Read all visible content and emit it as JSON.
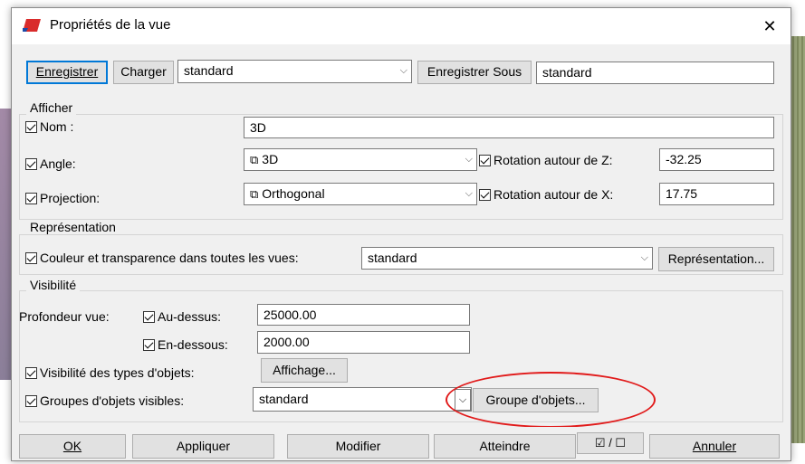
{
  "window": {
    "title": "Propriétés de la vue",
    "close_glyph": "✕"
  },
  "toolbar": {
    "save_label": "Enregistrer",
    "load_label": "Charger",
    "preset_value": "standard",
    "save_as_label": "Enregistrer Sous",
    "save_as_value": "standard"
  },
  "afficher": {
    "legend": "Afficher",
    "nom_label": "Nom :",
    "nom_value": "3D",
    "angle_label": "Angle:",
    "angle_value": "3D",
    "projection_label": "Projection:",
    "projection_value": "Orthogonal",
    "rot_z_label": "Rotation autour de Z:",
    "rot_z_value": "-32.25",
    "rot_x_label": "Rotation autour de X:",
    "rot_x_value": "17.75"
  },
  "representation": {
    "legend": "Représentation",
    "color_label": "Couleur et transparence dans toutes les vues:",
    "color_value": "standard",
    "button_label": "Représentation..."
  },
  "visibilite": {
    "legend": "Visibilité",
    "profondeur_label": "Profondeur vue:",
    "au_dessus_label": "Au-dessus:",
    "au_dessus_value": "25000.00",
    "en_dessous_label": "En-dessous:",
    "en_dessous_value": "2000.00",
    "types_label": "Visibilité des types d'objets:",
    "affichage_button": "Affichage...",
    "groupes_label": "Groupes d'objets visibles:",
    "groupes_value": "standard",
    "groupe_button": "Groupe d'objets..."
  },
  "footer": {
    "ok": "OK",
    "appliquer": "Appliquer",
    "modifier": "Modifier",
    "atteindre": "Atteindre",
    "toggle_glyph": "☑ / ☐",
    "annuler": "Annuler"
  },
  "colors": {
    "accent": "#0078d7",
    "annotation": "#e11a1a",
    "app_icon": "#d92b2b"
  }
}
